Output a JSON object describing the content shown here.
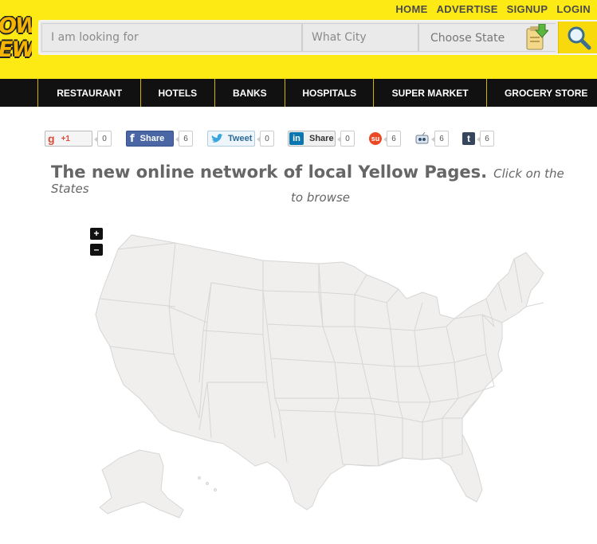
{
  "logo": {
    "line1": "OW",
    "line2": "EW"
  },
  "toplinks": [
    "HOME",
    "ADVERTISE",
    "SIGNUP",
    "LOGIN"
  ],
  "search": {
    "looking_placeholder": "I am looking for",
    "city_placeholder": "What City",
    "state_label": "Choose State"
  },
  "nav": [
    "RESTAURANT",
    "HOTELS",
    "BANKS",
    "HOSPITALS",
    "SUPER MARKET",
    "GROCERY STORE"
  ],
  "share": {
    "gplus": {
      "label": "+1",
      "count": "0"
    },
    "facebook": {
      "label": "Share",
      "count": "6"
    },
    "twitter": {
      "label": "Tweet",
      "count": "0"
    },
    "linkedin": {
      "label": "Share",
      "count": "0"
    },
    "stumble": {
      "count": "6"
    },
    "digg": {
      "count": "6"
    },
    "tumblr": {
      "count": "6"
    }
  },
  "headline": {
    "title": "The new online network of local Yellow Pages.",
    "sub1": "Click on the States",
    "sub2": "to browse"
  },
  "map": {
    "zoom_in": "+",
    "zoom_out": "–"
  },
  "colors": {
    "header": "#fdea14",
    "nav": "#111111",
    "map_fill": "#f0efed",
    "map_stroke": "#d6d6d6"
  }
}
